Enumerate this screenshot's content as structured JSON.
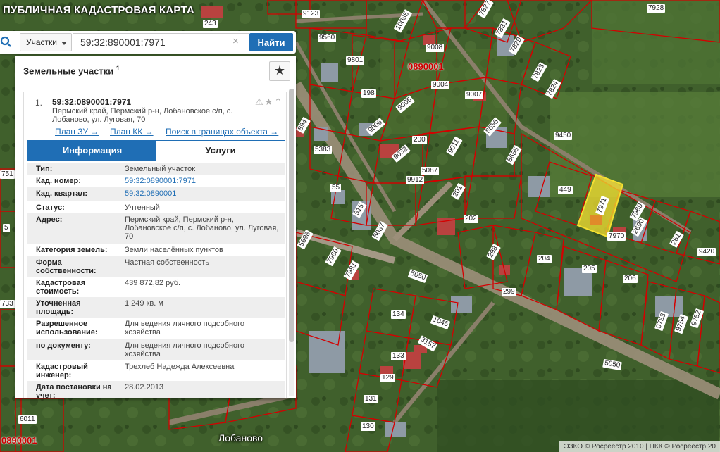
{
  "app": {
    "title": "ПУБЛИЧНАЯ КАДАСТРОВАЯ КАРТА"
  },
  "search": {
    "type_label": "Участки",
    "value": "59:32:890001:7971",
    "clear_glyph": "×",
    "find_label": "Найти"
  },
  "panel": {
    "title": "Земельные участки",
    "count": "1",
    "favorites_glyph": "★"
  },
  "result": {
    "index": "1.",
    "cadnum": "59:32:0890001:7971",
    "address": "Пермский край, Пермский р-н, Лобановское с/п, с. Лобаново, ул. Луговая, 70",
    "icons": "⚠★⌃",
    "links": [
      "План ЗУ →",
      "План КК →",
      "Поиск в границах объекта →"
    ]
  },
  "tabs": [
    "Информация",
    "Услуги"
  ],
  "properties": [
    {
      "key": "Тип:",
      "value": "Земельный участок"
    },
    {
      "key": "Кад. номер:",
      "value": "59:32:0890001:7971",
      "link": true
    },
    {
      "key": "Кад. квартал:",
      "value": "59:32:0890001",
      "link": true
    },
    {
      "key": "Статус:",
      "value": "Учтенный"
    },
    {
      "key": "Адрес:",
      "value": "Пермский край, Пермский р-н, Лобановское с/п, с. Лобаново, ул. Луговая, 70"
    },
    {
      "key": "Категория земель:",
      "value": "Земли населённых пунктов"
    },
    {
      "key": "Форма собственности:",
      "value": "Частная собственность"
    },
    {
      "key": "Кадастровая стоимость:",
      "value": "439 872,82 руб."
    },
    {
      "key": "Уточненная площадь:",
      "value": "1 249 кв. м"
    },
    {
      "key": "Разрешенное использование:",
      "value": "Для ведения личного подсобного хозяйства"
    },
    {
      "key": "по документу:",
      "value": "Для ведения личного подсобного хозяйства"
    },
    {
      "key": "Кадастровый инженер:",
      "value": "Трехлеб Надежда Алексеевна"
    },
    {
      "key": "Дата постановки на учет:",
      "value": "28.02.2013"
    }
  ],
  "map": {
    "quarter_labels": [
      "0890001",
      "0890001"
    ],
    "town_label": "Лобаново",
    "road_labels": [
      "5050",
      "5050"
    ],
    "plot_labels": [
      "9123",
      "10085",
      "7827",
      "7928",
      "243",
      "9560",
      "9008",
      "7831",
      "7829",
      "9801",
      "9004",
      "7823",
      "7824",
      "198",
      "9005",
      "9007",
      "9450",
      "8656",
      "5383",
      "9006",
      "200",
      "9032",
      "9011",
      "8655",
      "5087",
      "9912",
      "449",
      "7971",
      "7969",
      "261",
      "9420",
      "55",
      "201",
      "202",
      "7970",
      "2690",
      "515",
      "5037",
      "5698",
      "298",
      "299",
      "204",
      "205",
      "206",
      "7960",
      "7981",
      "134",
      "1046",
      "9753",
      "9754",
      "9752",
      "133",
      "3157",
      "129",
      "131",
      "130",
      "6011",
      "751",
      "5",
      "733",
      "894",
      "5050"
    ],
    "attribution": "ЭЗКО © Росреестр 2010 | ПКК © Росреестр 20"
  },
  "colors": {
    "accent": "#1f6eb5",
    "parcel_border": "#d40000",
    "selected_parcel": "#f5e030"
  }
}
